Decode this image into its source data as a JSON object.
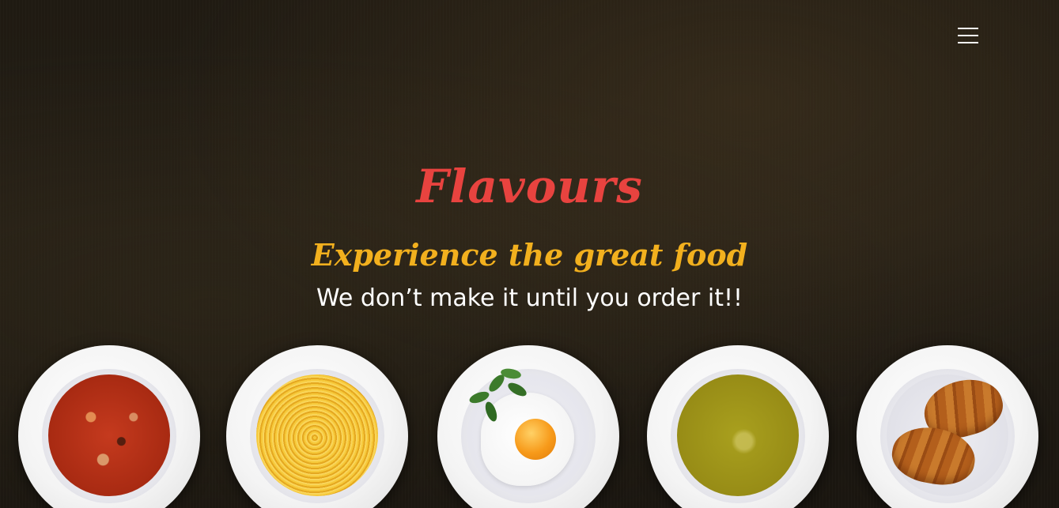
{
  "header": {
    "menu_icon": "hamburger-menu-icon"
  },
  "hero": {
    "brand": "Flavours",
    "tagline": "Experience the great food",
    "subtitle": "We don’t make it until you order it!!"
  },
  "dishes": [
    {
      "name": "tomato-vegetable-soup",
      "icon": "soup-plate"
    },
    {
      "name": "spaghetti",
      "icon": "pasta-plate"
    },
    {
      "name": "fried-egg",
      "icon": "egg-plate"
    },
    {
      "name": "green-pea-soup",
      "icon": "soup-plate"
    },
    {
      "name": "croissants",
      "icon": "croissant-plate"
    }
  ],
  "colors": {
    "brand": "#e8433f",
    "tagline": "#f2b01e",
    "subtitle": "#ffffff",
    "background": "#221c14"
  }
}
